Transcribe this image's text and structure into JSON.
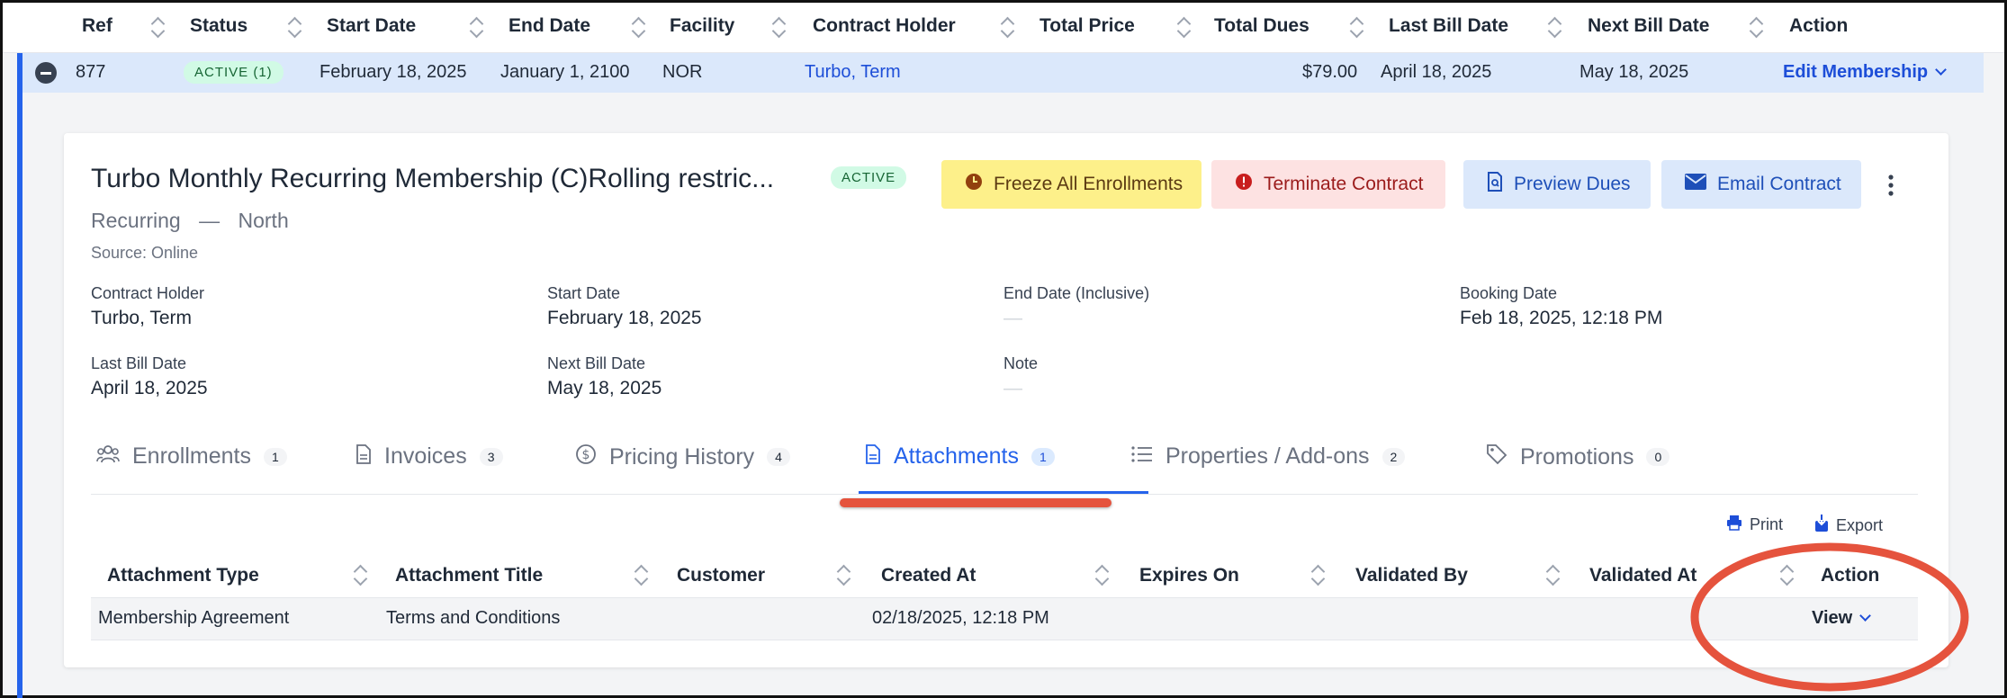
{
  "table_header": {
    "columns": [
      "Ref",
      "Status",
      "Start Date",
      "End Date",
      "Facility",
      "Contract Holder",
      "Total Price",
      "Total Dues",
      "Last Bill Date",
      "Next Bill Date",
      "Action"
    ]
  },
  "row": {
    "ref": "877",
    "status": "ACTIVE (1)",
    "start_date": "February 18, 2025",
    "end_date": "January 1, 2100",
    "facility": "NOR",
    "contract_holder": "Turbo, Term",
    "total_dues": "$79.00",
    "last_bill_date": "April 18, 2025",
    "next_bill_date": "May 18, 2025",
    "action": "Edit Membership"
  },
  "detail": {
    "title": "Turbo Monthly Recurring Membership (C)Rolling restric...",
    "status_badge": "ACTIVE",
    "subtitle_type": "Recurring",
    "subtitle_sep": "—",
    "subtitle_location": "North",
    "source": "Source: Online",
    "buttons": {
      "freeze": "Freeze All Enrollments",
      "terminate": "Terminate Contract",
      "preview": "Preview Dues",
      "email": "Email Contract"
    },
    "fields": {
      "contract_holder_label": "Contract Holder",
      "contract_holder_value": "Turbo, Term",
      "start_date_label": "Start Date",
      "start_date_value": "February 18, 2025",
      "end_date_label": "End Date (Inclusive)",
      "end_date_value": "—",
      "booking_date_label": "Booking Date",
      "booking_date_value": "Feb 18, 2025, 12:18 PM",
      "last_bill_label": "Last Bill Date",
      "last_bill_value": "April 18, 2025",
      "next_bill_label": "Next Bill Date",
      "next_bill_value": "May 18, 2025",
      "note_label": "Note",
      "note_value": "—"
    },
    "tabs": [
      {
        "label": "Enrollments",
        "count": "1"
      },
      {
        "label": "Invoices",
        "count": "3"
      },
      {
        "label": "Pricing History",
        "count": "4"
      },
      {
        "label": "Attachments",
        "count": "1"
      },
      {
        "label": "Properties / Add-ons",
        "count": "2"
      },
      {
        "label": "Promotions",
        "count": "0"
      }
    ],
    "toolbar": {
      "print": "Print",
      "export": "Export"
    },
    "attachments": {
      "columns": [
        "Attachment Type",
        "Attachment Title",
        "Customer",
        "Created At",
        "Expires On",
        "Validated By",
        "Validated At",
        "Action"
      ],
      "rows": [
        {
          "type": "Membership Agreement",
          "title": "Terms and Conditions",
          "customer": "",
          "created_at": "02/18/2025, 12:18 PM",
          "action": "View"
        }
      ]
    }
  },
  "colors": {
    "accent": "#2563eb",
    "annotation": "#e5533d",
    "freeze_bg": "#fdf08a",
    "terminate_bg": "#fde2e2",
    "preview_bg": "#dbe8fb"
  }
}
